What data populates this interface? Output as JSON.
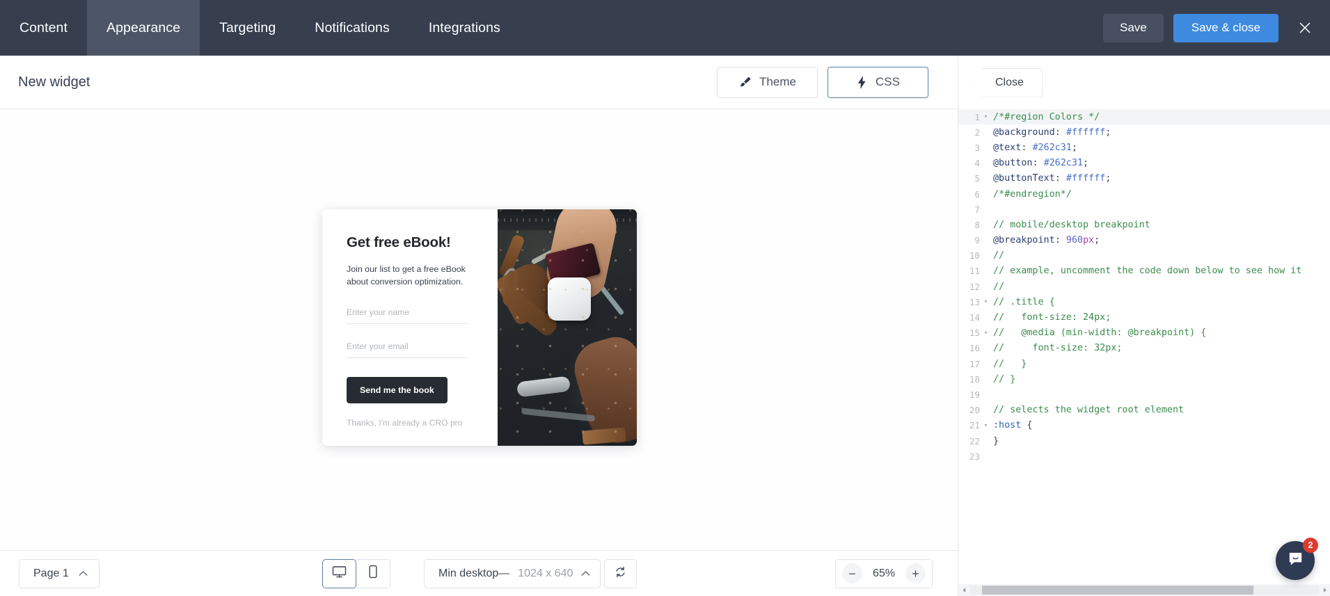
{
  "header": {
    "tabs": [
      {
        "label": "Content",
        "active": false
      },
      {
        "label": "Appearance",
        "active": true
      },
      {
        "label": "Targeting",
        "active": false
      },
      {
        "label": "Notifications",
        "active": false
      },
      {
        "label": "Integrations",
        "active": false
      }
    ],
    "save_label": "Save",
    "save_close_label": "Save & close",
    "close_icon": "close-icon",
    "bg_color": "#373f4f",
    "active_tab_color": "#4d5666",
    "primary_color": "#3e8ae0"
  },
  "subbar": {
    "widget_title": "New widget",
    "theme_label": "Theme",
    "theme_icon": "paintbrush-icon",
    "css_label": "CSS",
    "css_icon": "lightning-bolt-icon",
    "active_mode": "CSS"
  },
  "widget_preview": {
    "title": "Get free eBook!",
    "subtitle": "Join our list to get a free eBook about conversion optimization.",
    "name_placeholder": "Enter your name",
    "email_placeholder": "Enter your email",
    "button_label": "Send me the book",
    "dismiss_label": "Thanks, I'm already a CRO pro",
    "button_bg": "#262c31",
    "button_text_color": "#ffffff",
    "image_alt": "hands-holding-credit-card-and-card-reader-photo"
  },
  "bottombar": {
    "page_label": "Page 1",
    "page_chevron": "chevron-up-icon",
    "desktop_icon": "desktop-monitor-icon",
    "mobile_icon": "mobile-phone-icon",
    "active_device": "desktop",
    "viewport_label": "Min desktop—",
    "viewport_dimensions": "1024 x 640",
    "viewport_chevron": "chevron-up-icon",
    "refresh_icon": "refresh-icon",
    "zoom_out_label": "−",
    "zoom_value": "65%",
    "zoom_in_label": "+"
  },
  "code_panel": {
    "close_label": "Close",
    "lines": [
      {
        "num": "1",
        "fold": "▾",
        "highlight": true,
        "tokens": [
          {
            "t": "/*#region Colors */",
            "c": "c-comment"
          }
        ]
      },
      {
        "num": "2",
        "fold": "",
        "tokens": [
          {
            "t": "@background",
            "c": "c-var"
          },
          {
            "t": ": ",
            "c": "c-punct"
          },
          {
            "t": "#ffffff",
            "c": "c-hex"
          },
          {
            "t": ";",
            "c": "c-punct"
          }
        ]
      },
      {
        "num": "3",
        "fold": "",
        "tokens": [
          {
            "t": "@text",
            "c": "c-var"
          },
          {
            "t": ": ",
            "c": "c-punct"
          },
          {
            "t": "#262c31",
            "c": "c-hex"
          },
          {
            "t": ";",
            "c": "c-punct"
          }
        ]
      },
      {
        "num": "4",
        "fold": "",
        "tokens": [
          {
            "t": "@button",
            "c": "c-var"
          },
          {
            "t": ": ",
            "c": "c-punct"
          },
          {
            "t": "#262c31",
            "c": "c-hex"
          },
          {
            "t": ";",
            "c": "c-punct"
          }
        ]
      },
      {
        "num": "5",
        "fold": "",
        "tokens": [
          {
            "t": "@buttonText",
            "c": "c-var"
          },
          {
            "t": ": ",
            "c": "c-punct"
          },
          {
            "t": "#ffffff",
            "c": "c-hex"
          },
          {
            "t": ";",
            "c": "c-punct"
          }
        ]
      },
      {
        "num": "6",
        "fold": "",
        "tokens": [
          {
            "t": "/*#endregion*/",
            "c": "c-comment"
          }
        ]
      },
      {
        "num": "7",
        "fold": "",
        "tokens": []
      },
      {
        "num": "8",
        "fold": "",
        "tokens": [
          {
            "t": "// mobile/desktop breakpoint",
            "c": "c-comment"
          }
        ]
      },
      {
        "num": "9",
        "fold": "",
        "tokens": [
          {
            "t": "@breakpoint",
            "c": "c-var"
          },
          {
            "t": ": ",
            "c": "c-punct"
          },
          {
            "t": "960",
            "c": "c-num"
          },
          {
            "t": "px",
            "c": "c-unit"
          },
          {
            "t": ";",
            "c": "c-punct"
          }
        ]
      },
      {
        "num": "10",
        "fold": "",
        "tokens": [
          {
            "t": "//",
            "c": "c-comment"
          }
        ]
      },
      {
        "num": "11",
        "fold": "",
        "tokens": [
          {
            "t": "// example, uncomment the code down below to see how it",
            "c": "c-comment"
          }
        ]
      },
      {
        "num": "12",
        "fold": "",
        "tokens": [
          {
            "t": "//",
            "c": "c-comment"
          }
        ]
      },
      {
        "num": "13",
        "fold": "▾",
        "tokens": [
          {
            "t": "// .title {",
            "c": "c-comment"
          }
        ]
      },
      {
        "num": "14",
        "fold": "",
        "tokens": [
          {
            "t": "//   font-size: 24px;",
            "c": "c-comment"
          }
        ]
      },
      {
        "num": "15",
        "fold": "▾",
        "tokens": [
          {
            "t": "//   @media (min-width: @breakpoint) {",
            "c": "c-comment"
          }
        ]
      },
      {
        "num": "16",
        "fold": "",
        "tokens": [
          {
            "t": "//     font-size: 32px;",
            "c": "c-comment"
          }
        ]
      },
      {
        "num": "17",
        "fold": "",
        "tokens": [
          {
            "t": "//   }",
            "c": "c-comment"
          }
        ]
      },
      {
        "num": "18",
        "fold": "",
        "tokens": [
          {
            "t": "// }",
            "c": "c-comment"
          }
        ]
      },
      {
        "num": "19",
        "fold": "",
        "tokens": []
      },
      {
        "num": "20",
        "fold": "",
        "tokens": [
          {
            "t": "// selects the widget root element",
            "c": "c-comment"
          }
        ]
      },
      {
        "num": "21",
        "fold": "▾",
        "tokens": [
          {
            "t": ":host",
            "c": "c-sel"
          },
          {
            "t": " {",
            "c": "c-punct"
          }
        ]
      },
      {
        "num": "22",
        "fold": "",
        "tokens": [
          {
            "t": "}",
            "c": "c-punct"
          }
        ]
      },
      {
        "num": "23",
        "fold": "",
        "tokens": []
      }
    ]
  },
  "chat": {
    "icon": "chat-bubble-icon",
    "badge_count": "2",
    "badge_color": "#e03a2f",
    "bubble_color": "#2f3b52"
  }
}
